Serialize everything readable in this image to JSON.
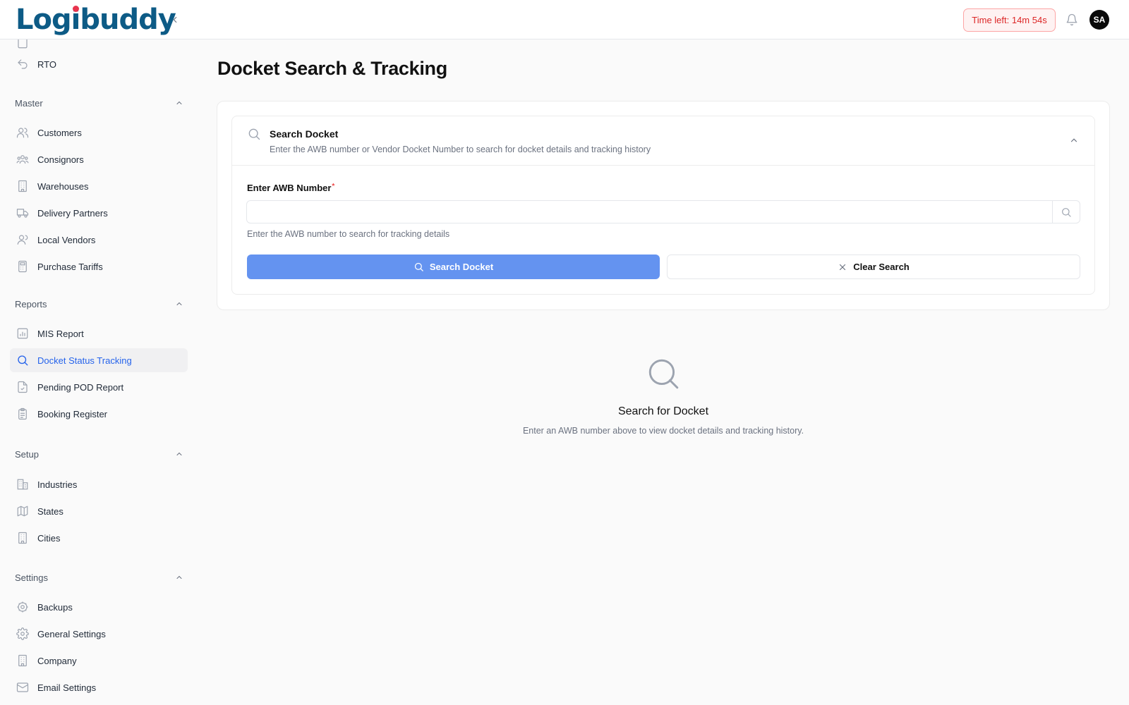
{
  "brand": {
    "logo_text_a": "Log",
    "logo_text_i": "i",
    "logo_text_b": "buddy"
  },
  "header": {
    "timer": "Time left: 14m 54s",
    "avatar_initials": "SA"
  },
  "sidebar": {
    "top_items": [
      {
        "label": "RTO",
        "icon": "undo-icon"
      }
    ],
    "sections": {
      "master": {
        "label": "Master",
        "items": [
          {
            "label": "Customers",
            "icon": "users-icon"
          },
          {
            "label": "Consignors",
            "icon": "group-icon"
          },
          {
            "label": "Warehouses",
            "icon": "building-icon"
          },
          {
            "label": "Delivery Partners",
            "icon": "truck-icon"
          },
          {
            "label": "Local Vendors",
            "icon": "user-icon"
          },
          {
            "label": "Purchase Tariffs",
            "icon": "calculator-icon"
          }
        ]
      },
      "reports": {
        "label": "Reports",
        "items": [
          {
            "label": "MIS Report",
            "icon": "bar-chart-icon"
          },
          {
            "label": "Docket Status Tracking",
            "icon": "search-icon",
            "active": true
          },
          {
            "label": "Pending POD Report",
            "icon": "file-check-icon"
          },
          {
            "label": "Booking Register",
            "icon": "clipboard-icon"
          }
        ]
      },
      "setup": {
        "label": "Setup",
        "items": [
          {
            "label": "Industries",
            "icon": "factory-icon"
          },
          {
            "label": "States",
            "icon": "map-icon"
          },
          {
            "label": "Cities",
            "icon": "building-icon"
          }
        ]
      },
      "settings": {
        "label": "Settings",
        "items": [
          {
            "label": "Backups",
            "icon": "backup-icon"
          },
          {
            "label": "General Settings",
            "icon": "gear-icon"
          },
          {
            "label": "Company",
            "icon": "building-icon"
          },
          {
            "label": "Email Settings",
            "icon": "mail-icon"
          }
        ]
      }
    }
  },
  "main": {
    "title": "Docket Search & Tracking",
    "search_card": {
      "title": "Search Docket",
      "description": "Enter the AWB number or Vendor Docket Number to search for docket details and tracking history",
      "field_label": "Enter AWB Number",
      "required_mark": "*",
      "input_value": "",
      "hint": "Enter the AWB number to search for tracking details",
      "search_button": "Search Docket",
      "clear_button": "Clear Search"
    },
    "empty_state": {
      "title": "Search for Docket",
      "description": "Enter an AWB number above to view docket details and tracking history."
    }
  },
  "colors": {
    "primary": "#6493f0",
    "active": "#2563eb",
    "danger": "#dc2626",
    "brand": "#0d5b86"
  }
}
